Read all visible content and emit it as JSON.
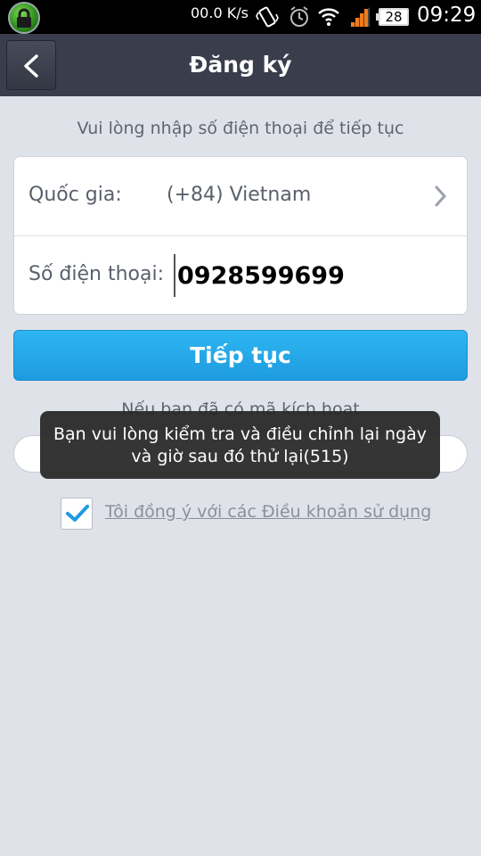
{
  "status_bar": {
    "net_speed": "00.0 K/s",
    "battery": "28",
    "time": "09:29"
  },
  "header": {
    "title": "Đăng ký"
  },
  "form": {
    "instruction": "Vui lòng nhập số điện thoại để tiếp tục",
    "country_label": "Quốc gia:",
    "country_value": "(+84) Vietnam",
    "phone_label": "Số điện thoại:",
    "phone_value": "0928599699"
  },
  "continue_button": "Tiếp tục",
  "activation": {
    "text": "Nếu bạn đã có mã kích hoạt"
  },
  "terms": {
    "checked": true,
    "label": "Tôi đồng ý với các Điều khoản sử dụng"
  },
  "toast": {
    "line1": "Bạn vui lòng kiểm tra và điều chỉnh lại ngày",
    "line2": "và giờ sau đó thử lại(515)"
  },
  "colors": {
    "header_bg": "#3a3e4c",
    "accent": "#1e9be0",
    "page_bg": "#dfe3e9"
  }
}
